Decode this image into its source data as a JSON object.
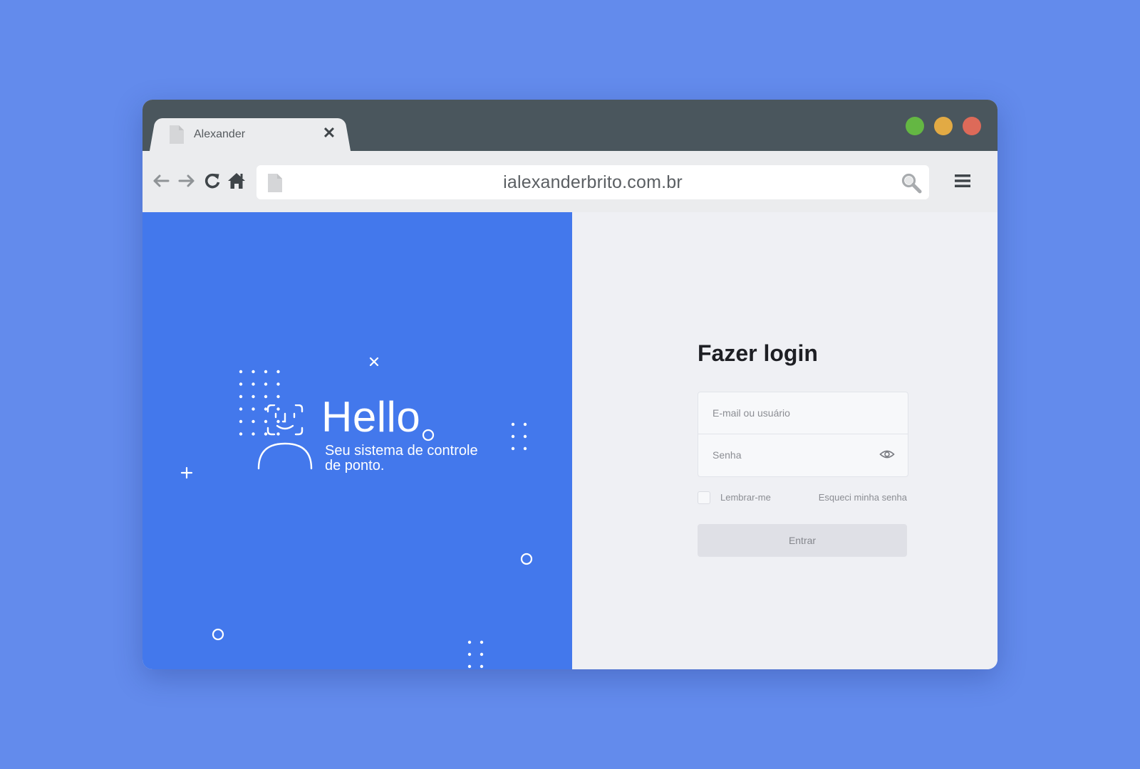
{
  "browser": {
    "tab": {
      "title": "Alexander",
      "close": "✕"
    },
    "address_bar": {
      "url": "ialexanderbrito.com.br"
    },
    "window_controls": [
      "green",
      "yellow",
      "red"
    ],
    "colors": {
      "titlebar": "#4a565d",
      "toolbar": "#ebecee"
    }
  },
  "icons": {
    "tab_page": "page-icon",
    "back": "arrow-left-icon",
    "forward": "arrow-right-icon",
    "reload": "reload-icon",
    "home": "home-icon",
    "url_page": "page-icon",
    "search": "search-icon",
    "menu": "hamburger-menu-icon",
    "face_id": "face-id-user-icon",
    "eye": "eye-icon"
  },
  "hero": {
    "title": "Hello",
    "subtitle": "Seu sistema de controle de ponto.",
    "background": "#4378ec"
  },
  "login": {
    "title": "Fazer login",
    "email_placeholder": "E-mail ou usuário",
    "password_placeholder": "Senha",
    "remember_label": "Lembrar-me",
    "forgot_label": "Esqueci minha senha",
    "submit_label": "Entrar"
  },
  "page": {
    "background": "#638bec"
  }
}
